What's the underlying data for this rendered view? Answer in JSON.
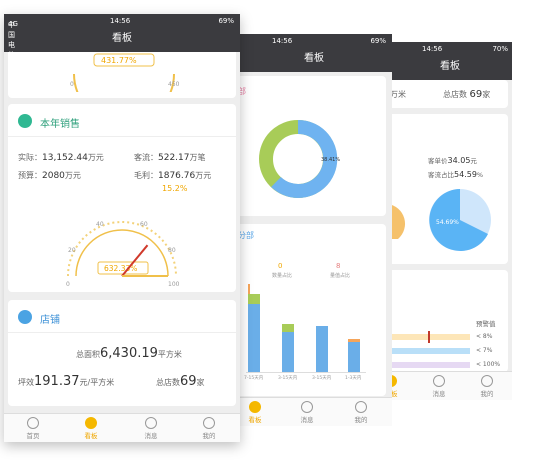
{
  "phone1": {
    "status": {
      "carrier": "中国电信",
      "network": "4G",
      "time": "14:56",
      "battery": "69%"
    },
    "title": "看板",
    "top_gauge": {
      "value": "431.77%",
      "min": "0",
      "max": "450"
    },
    "sales": {
      "heading": "本年销售",
      "actual_label": "实际：",
      "actual_value": "13,152.44",
      "actual_unit": "万元",
      "traffic_label": "客流：",
      "traffic_value": "522.17",
      "traffic_unit": "万笔",
      "budget_label": "预算：",
      "budget_value": "2080",
      "budget_unit": "万元",
      "margin_label": "毛利：",
      "margin_value": "1876.76",
      "margin_unit": "万元",
      "margin_pct": "15.2%",
      "gauge": {
        "value": "632.33%",
        "ticks": [
          "0",
          "20",
          "40",
          "60",
          "80",
          "100"
        ],
        "percent": 0.72
      }
    },
    "stores": {
      "heading": "店铺",
      "area_label": "总面积",
      "area_value": "6,430.19",
      "area_unit": "平方米",
      "ping_label": "坪效",
      "ping_value": "191.37",
      "ping_unit": "元/平方米",
      "count_label": "总店数",
      "count_value": "69",
      "count_unit": "家"
    },
    "tabs": [
      "首页",
      "看板",
      "消息",
      "我的"
    ]
  },
  "phone2": {
    "status": {
      "time": "14:56",
      "battery": "69%"
    },
    "title": "看板",
    "card1_heading": "部",
    "donut_label": "38.41%",
    "card2_heading": "分部",
    "legend_a": "0",
    "legend_a_label": "数量占比",
    "legend_b": "8",
    "legend_b_label": "量值占比",
    "bar_labels": [
      "7-15天内",
      "3-15天内",
      "3-15天内",
      "1-3天内"
    ],
    "tabs": [
      "看板",
      "消息",
      "我的"
    ]
  },
  "phone3": {
    "status": {
      "time": "14:56",
      "battery": "70%"
    },
    "title": "看板",
    "top_left": "万米",
    "top_right_label": "总店数",
    "top_right_value": "69",
    "top_right_unit": "家",
    "stat1_label": "客单价",
    "stat1_value": "34.05",
    "stat1_unit": "元",
    "stat2_label": "客流占比",
    "stat2_value": "54.59",
    "stat2_unit": "%",
    "pie_label": "54.69%",
    "forecast_label": "预警值",
    "rows": [
      "< 8%",
      "< 7%",
      "< 100%"
    ],
    "tabs": [
      "看板",
      "消息",
      "我的"
    ]
  }
}
